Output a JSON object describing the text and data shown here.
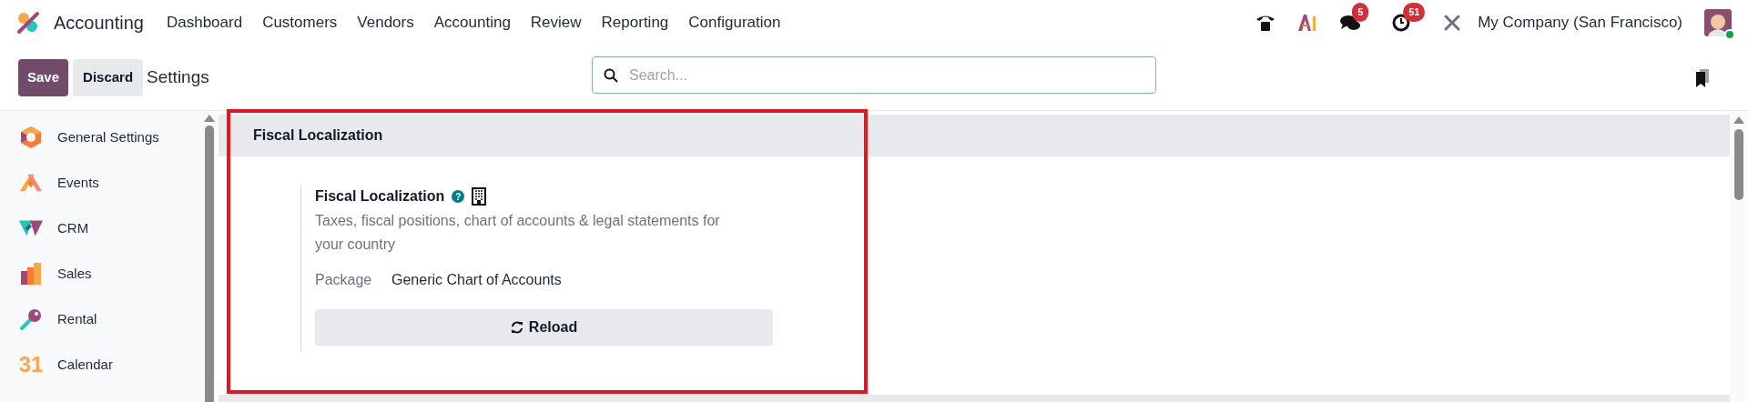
{
  "app": {
    "name": "Accounting"
  },
  "menu": [
    "Dashboard",
    "Customers",
    "Vendors",
    "Accounting",
    "Review",
    "Reporting",
    "Configuration"
  ],
  "systray": {
    "messages_count": "5",
    "activities_count": "51",
    "company": "My Company (San Francisco)",
    "online": true
  },
  "control_panel": {
    "save": "Save",
    "discard": "Discard",
    "title": "Settings",
    "search": {
      "placeholder": "Search..."
    }
  },
  "sidebar": {
    "items": [
      {
        "kind": "general",
        "label": "General Settings"
      },
      {
        "kind": "events",
        "label": "Events"
      },
      {
        "kind": "crm",
        "label": "CRM"
      },
      {
        "kind": "sales",
        "label": "Sales"
      },
      {
        "kind": "rental",
        "label": "Rental"
      },
      {
        "kind": "calendar",
        "label": "Calendar",
        "icon_text": "31"
      }
    ]
  },
  "section": {
    "title": "Fiscal Localization",
    "highlighted": true,
    "setting": {
      "title": "Fiscal Localization",
      "help": "?",
      "description": "Taxes, fiscal positions, chart of accounts & legal statements for your country",
      "field_label": "Package",
      "field_value": "Generic Chart of Accounts",
      "button": "Reload"
    }
  }
}
